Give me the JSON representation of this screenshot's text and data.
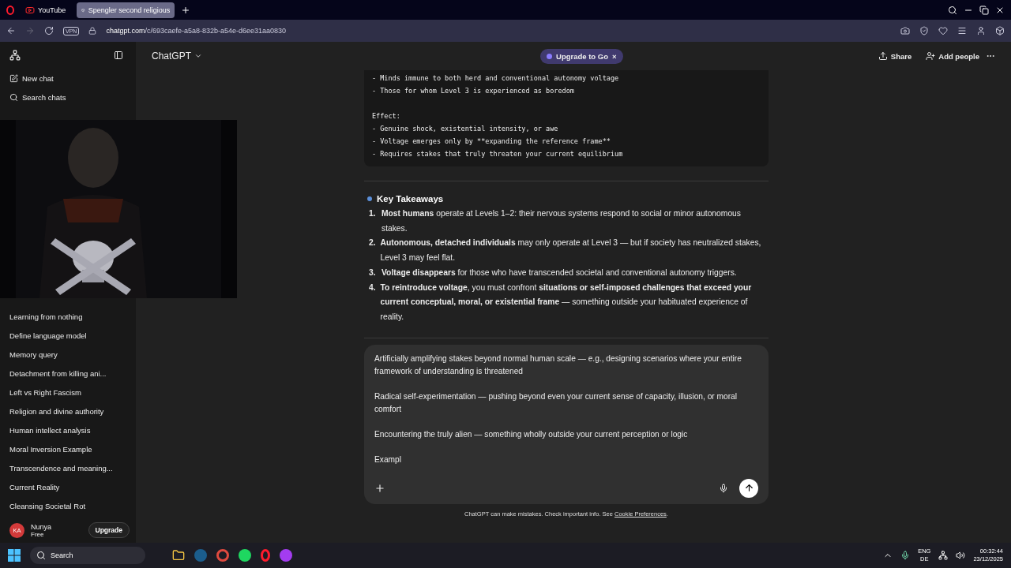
{
  "browser": {
    "tabs": [
      {
        "label": "YouTube",
        "selected": false
      },
      {
        "label": "Spengler second religious",
        "selected": true
      }
    ],
    "url_host": "chatgpt.com",
    "url_path": "/c/693caefe-a5a8-832b-a54e-d6ee31aa0830",
    "vpn": "VPN"
  },
  "sidebar": {
    "actions": [
      "New chat",
      "Search chats"
    ],
    "chats": [
      "Learning from nothing",
      "Define language model",
      "Memory query",
      "Detachment from killing ani...",
      "Left vs Right Fascism",
      "Religion and divine authority",
      "Human intellect analysis",
      "Moral Inversion Example",
      "Transcendence and meaning...",
      "Current Reality",
      "Cleansing Societal Rot"
    ],
    "user": {
      "initials": "KA",
      "name": "Nunya",
      "plan": "Free",
      "upgrade": "Upgrade"
    }
  },
  "header": {
    "model": "ChatGPT",
    "promo": "Upgrade to Go",
    "promo_close": "×",
    "share": "Share",
    "add_people": "Add people"
  },
  "code_groups": [
    [
      "- Minds immune to both herd and conventional autonomy voltage",
      "- Those for whom Level 3 is experienced as boredom"
    ],
    [
      "Effect:",
      "- Genuine shock, existential intensity, or awe",
      "- Voltage emerges only by **expanding the reference frame**",
      "- Requires stakes that truly threaten your current equilibrium"
    ]
  ],
  "takeaways": {
    "title": "Key Takeaways",
    "items": [
      {
        "number": "1.",
        "text": "**Most humans** operate at Levels 1–2: their nervous systems respond to social or minor autonomous stakes."
      },
      {
        "number": "2.",
        "text": "**Autonomous, detached individuals** may only operate at Level 3 — but if society has neutralized stakes, Level 3 may feel flat."
      },
      {
        "number": "3.",
        "text": "**Voltage disappears** for those who have transcended societal and conventional autonomy triggers."
      },
      {
        "number": "4.",
        "text": "**To reintroduce voltage**, you must confront **situations or self-imposed challenges that exceed your current conceptual, moral, or existential frame** — something outside your habituated experience of reality."
      }
    ]
  },
  "composer": {
    "paragraphs": [
      "Artificially amplifying stakes beyond normal human scale — e.g., designing scenarios where your entire framework of understanding is threatened",
      "Radical self-experimentation — pushing beyond even your current sense of capacity, illusion, or moral comfort",
      "Encountering the truly alien — something wholly outside your current perception or logic",
      "Exampl"
    ]
  },
  "footer": {
    "text": "ChatGPT can make mistakes. Check important info. See ",
    "link": "Cookie Preferences",
    "end": "."
  },
  "taskbar": {
    "search": "Search",
    "lang": "ENG",
    "layout": "DE",
    "time": "00:32:44",
    "date": "23/12/2025"
  }
}
